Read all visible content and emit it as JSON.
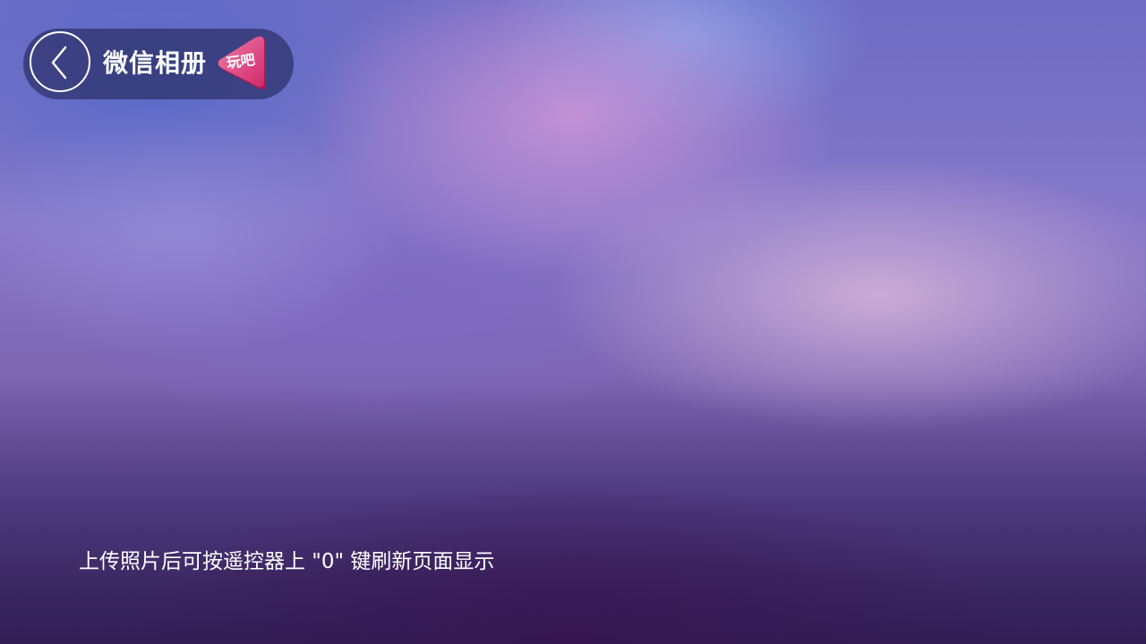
{
  "header": {
    "title": "微信相册",
    "badge_text": "玩吧",
    "back_icon": "chevron-left-icon",
    "badge_icon": "play-triangle-badge-icon"
  },
  "hint": {
    "text": "上传照片后可按遥控器上 \"0\" 键刷新页面显示"
  },
  "colors": {
    "pill_background": "#30346e",
    "badge_pink": "#e6457f",
    "text": "#ffffff"
  }
}
